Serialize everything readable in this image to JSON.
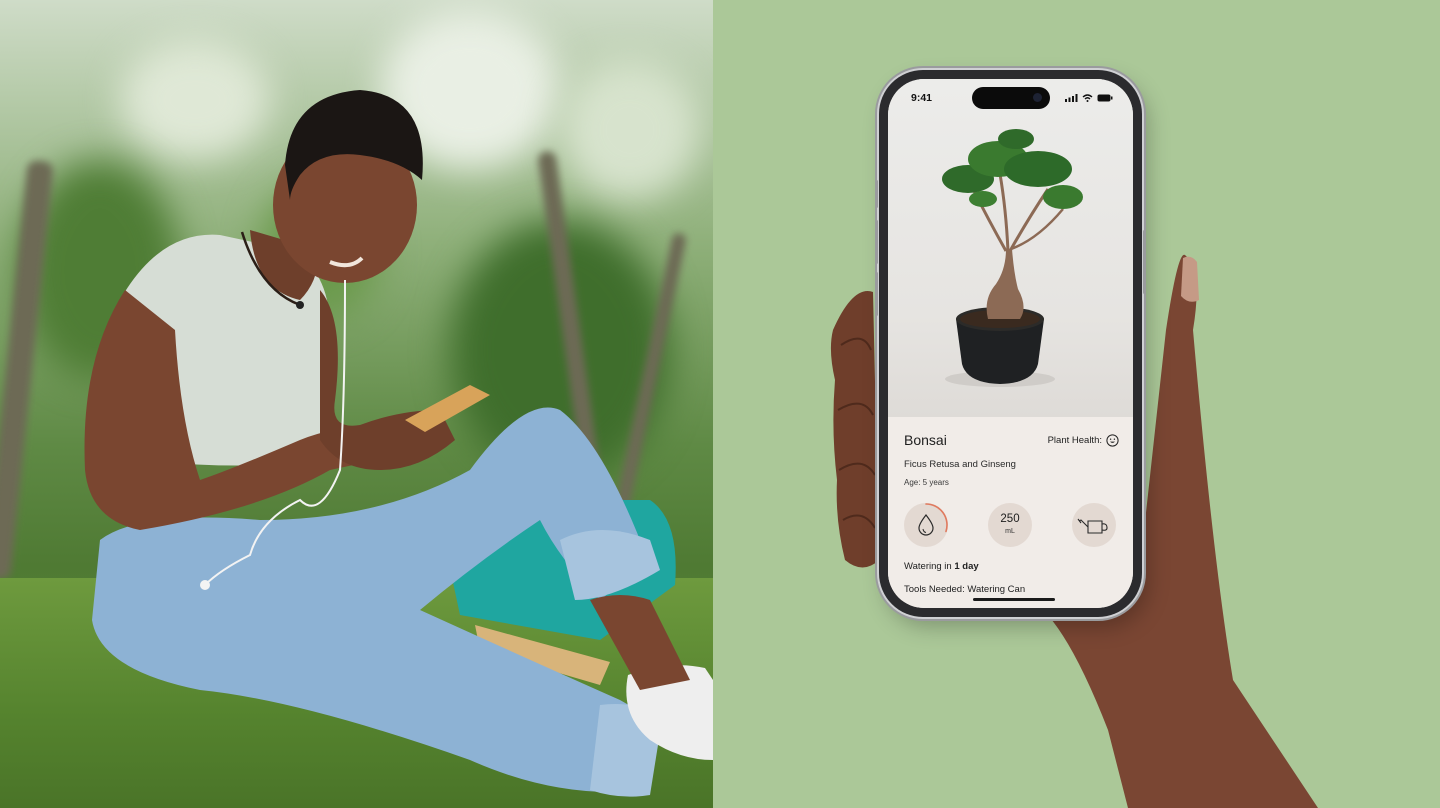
{
  "phone": {
    "status_time": "9:41",
    "plant": {
      "name": "Bonsai",
      "health_label": "Plant Health:",
      "health_icon": "smile-face-icon",
      "species": "Ficus Retusa and Ginseng",
      "age": "Age: 5 years"
    },
    "stats": {
      "water_icon": "water-drop-icon",
      "water_progress": 0.3,
      "amount_value": "250",
      "amount_unit": "mL",
      "tool_icon": "watering-can-icon"
    },
    "watering": {
      "prefix": "Watering in ",
      "value": "1 day"
    },
    "tools_needed": "Tools Needed: Watering Can"
  },
  "colors": {
    "panel_bg": "#abc898",
    "sheet_bg": "#f1ece8",
    "stat_bg": "#e3d9d2",
    "progress_accent": "#e07a5f"
  }
}
